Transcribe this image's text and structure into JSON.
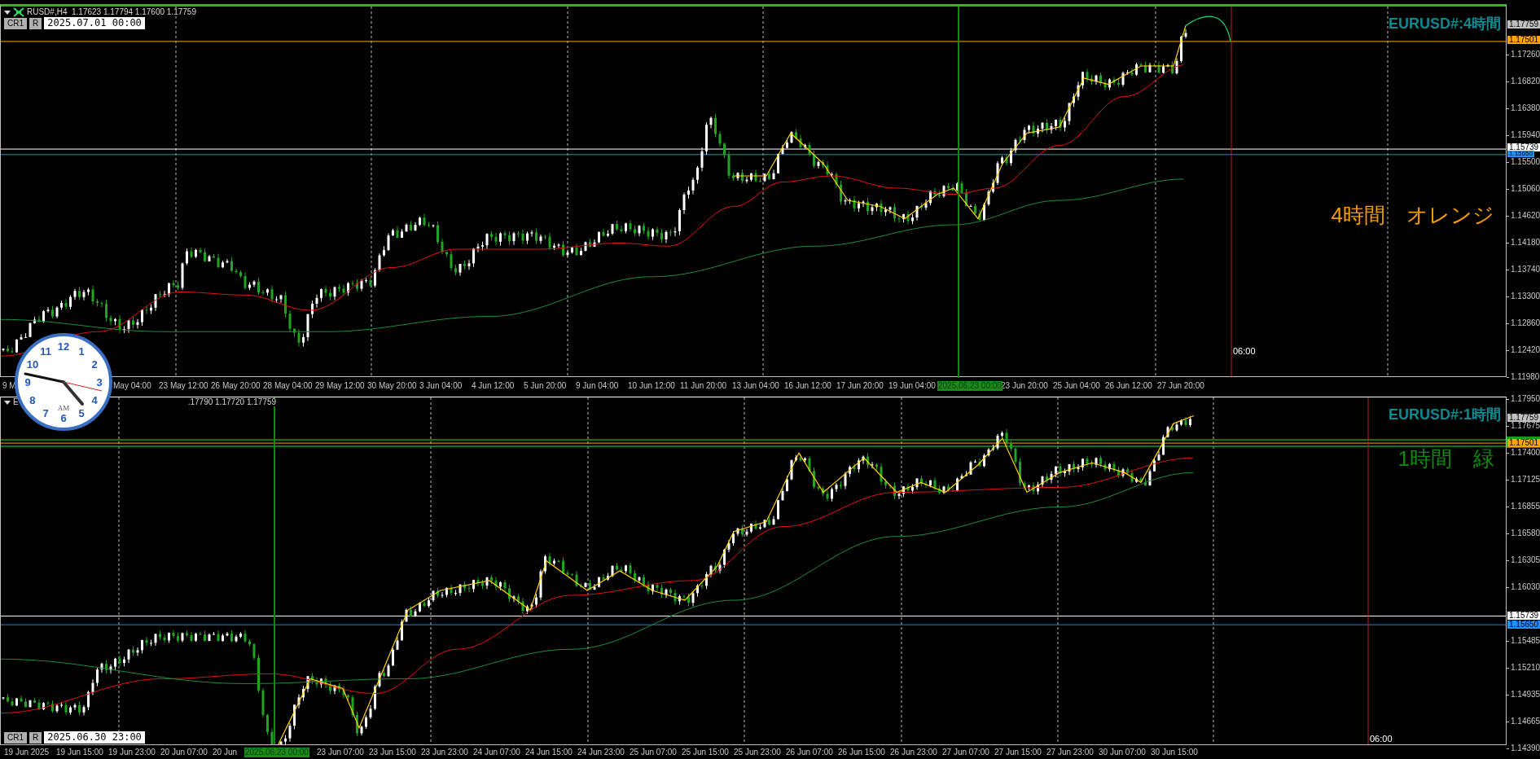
{
  "panels": [
    {
      "kind": "h4",
      "header": [
        "RUSD#,H4  1.17623 1.17794 1.17600 1.17759"
      ],
      "date_bar": {
        "buttons": [
          "CR1",
          "R"
        ],
        "value": "2025.07.01 00:00"
      },
      "title": "EURUSD#:4時間",
      "note": "4時間　オレンジ",
      "color": "#f39c00",
      "marker_time": "06:00",
      "price_ticks": [
        "1.17260",
        "1.16820",
        "1.16380",
        "1.15940",
        "1.15500",
        "1.15060",
        "1.14620",
        "1.14180",
        "1.13740",
        "1.13300",
        "1.12860",
        "1.12420",
        "1.11980"
      ],
      "badges": [
        {
          "text": "1.17759",
          "kind": "bid",
          "band": false
        },
        {
          "text": "1.17501",
          "kind": "orange",
          "band": false
        },
        {
          "text": "1.15739",
          "kind": "white",
          "band": false
        },
        {
          "text": "1.15650",
          "kind": "blue",
          "band": false
        }
      ],
      "time_axis": [
        {
          "text": "9 M"
        },
        {
          "text": "May 04:00"
        },
        {
          "text": "23 May 12:00"
        },
        {
          "text": "26 May 20:00"
        },
        {
          "text": "28 May 04:00"
        },
        {
          "text": "29 May 12:00"
        },
        {
          "text": "30 May 20:00"
        },
        {
          "text": "3 Jun 04:00"
        },
        {
          "text": "4 Jun 12:00"
        },
        {
          "text": "5 Jun 20:00"
        },
        {
          "text": "9 Jun 04:00"
        },
        {
          "text": "10 Jun 12:00"
        },
        {
          "text": "11 Jun 20:00"
        },
        {
          "text": "13 Jun 04:00"
        },
        {
          "text": "16 Jun 12:00"
        },
        {
          "text": "17 Jun 20:00"
        },
        {
          "text": "19 Jun 04:00"
        },
        {
          "text": "2025.06.23 00:00",
          "kind": "cursor"
        },
        {
          "text": "23 Jun 20:00"
        },
        {
          "text": "25 Jun 04:00"
        },
        {
          "text": "26 Jun 12:00"
        },
        {
          "text": "27 Jun 20:00"
        }
      ]
    },
    {
      "kind": "h1",
      "header": [
        "E",
        ".17790 1.17720 1.17759"
      ],
      "date_bar": {
        "buttons": [
          "CR1",
          "R"
        ],
        "value": "2025.06.30 23:00"
      },
      "title": "EURUSD#:1時間",
      "note": "1時間　緑",
      "color": "#0b8a0b",
      "marker_time": "06:00",
      "price_ticks": [
        "1.17950",
        "1.17675",
        "1.17400",
        "1.17125",
        "1.16855",
        "1.16580",
        "1.16305",
        "1.16030",
        "1.15485",
        "1.15210",
        "1.14935",
        "1.14665",
        "1.14390"
      ],
      "badges": [
        {
          "text": "1.17759",
          "kind": "bid",
          "band": false
        },
        {
          "text": "1.17501",
          "kind": "orange",
          "band": true
        },
        {
          "text": "1.15739",
          "kind": "white",
          "band": false
        },
        {
          "text": "1.15650",
          "kind": "blue",
          "band": false
        }
      ],
      "time_axis": [
        {
          "text": "19 Jun 2025"
        },
        {
          "text": "19 Jun 15:00"
        },
        {
          "text": "19 Jun 23:00"
        },
        {
          "text": "20 Jun 07:00"
        },
        {
          "text": "20 Jun"
        },
        {
          "text": "2025.06.23 00:00",
          "kind": "cursor"
        },
        {
          "text": "23 Jun 07:00"
        },
        {
          "text": "23 Jun 15:00"
        },
        {
          "text": "23 Jun 23:00"
        },
        {
          "text": "24 Jun 07:00"
        },
        {
          "text": "24 Jun 15:00"
        },
        {
          "text": "24 Jun 23:00"
        },
        {
          "text": "25 Jun 07:00"
        },
        {
          "text": "25 Jun 15:00"
        },
        {
          "text": "25 Jun 23:00"
        },
        {
          "text": "26 Jun 07:00"
        },
        {
          "text": "26 Jun 15:00"
        },
        {
          "text": "26 Jun 23:00"
        },
        {
          "text": "27 Jun 07:00"
        },
        {
          "text": "27 Jun 15:00"
        },
        {
          "text": "27 Jun 23:00"
        },
        {
          "text": "30 Jun 07:00"
        },
        {
          "text": "30 Jun 15:00"
        }
      ]
    }
  ],
  "clock": {
    "numerals": [
      "11",
      "12",
      "1",
      "10",
      "2",
      "9",
      "3",
      "8",
      "4",
      "7",
      "5",
      "6"
    ],
    "period": "AM"
  }
}
